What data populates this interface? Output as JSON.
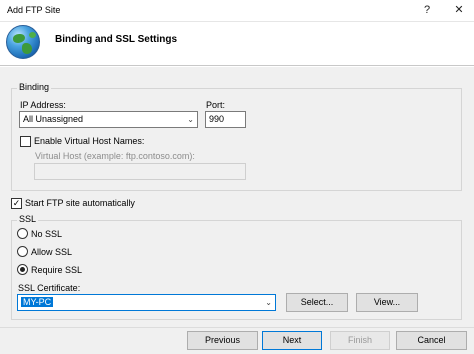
{
  "window": {
    "title": "Add FTP Site",
    "help_glyph": "?",
    "close_glyph": "✕"
  },
  "header": {
    "title": "Binding and SSL Settings",
    "icon": "globe-icon"
  },
  "binding": {
    "legend": "Binding",
    "ip_label": "IP Address:",
    "ip_value": "All Unassigned",
    "port_label": "Port:",
    "port_value": "990",
    "virtual_host_checkbox_label": "Enable Virtual Host Names:",
    "virtual_host_checked": false,
    "virtual_host_label": "Virtual Host (example: ftp.contoso.com):",
    "virtual_host_value": ""
  },
  "start_automatically": {
    "label": "Start FTP site automatically",
    "checked": true
  },
  "ssl": {
    "legend": "SSL",
    "options": [
      "No SSL",
      "Allow SSL",
      "Require SSL"
    ],
    "selected": "Require SSL",
    "certificate_label": "SSL Certificate:",
    "certificate_value": "MY-PC",
    "select_button": "Select...",
    "view_button": "View..."
  },
  "footer": {
    "previous": "Previous",
    "next": "Next",
    "finish": "Finish",
    "cancel": "Cancel"
  }
}
